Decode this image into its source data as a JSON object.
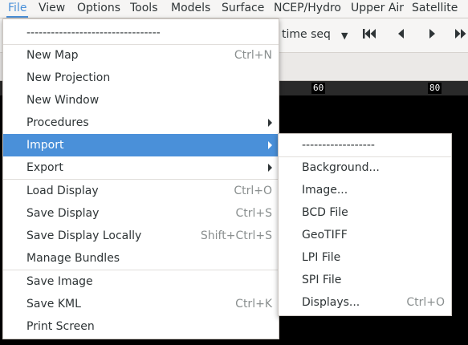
{
  "menubar": {
    "items": [
      "File",
      "View",
      "Options",
      "Tools",
      "Models",
      "Surface",
      "NCEP/Hydro",
      "Upper Air",
      "Satellite"
    ]
  },
  "toolbar": {
    "frame_select": "time seq",
    "ruler_labels": [
      "60",
      "80"
    ]
  },
  "file_menu": {
    "tearoff": "---------------------------------",
    "items": [
      {
        "label": "New Map",
        "accel": "Ctrl+N"
      },
      {
        "label": "New Projection",
        "accel": ""
      },
      {
        "label": "New Window",
        "accel": ""
      },
      {
        "label": "Procedures",
        "accel": ""
      },
      {
        "label": "Import",
        "accel": ""
      },
      {
        "label": "Export",
        "accel": ""
      },
      {
        "label": "Load Display",
        "accel": "Ctrl+O"
      },
      {
        "label": "Save Display",
        "accel": "Ctrl+S"
      },
      {
        "label": "Save Display Locally",
        "accel": "Shift+Ctrl+S"
      },
      {
        "label": "Manage Bundles",
        "accel": ""
      },
      {
        "label": "Save Image",
        "accel": ""
      },
      {
        "label": "Save KML",
        "accel": "Ctrl+K"
      },
      {
        "label": "Print Screen",
        "accel": ""
      }
    ]
  },
  "import_menu": {
    "tearoff": "------------------",
    "items": [
      {
        "label": "Background...",
        "accel": ""
      },
      {
        "label": "Image...",
        "accel": ""
      },
      {
        "label": "BCD File",
        "accel": ""
      },
      {
        "label": "GeoTIFF",
        "accel": ""
      },
      {
        "label": "LPI File",
        "accel": ""
      },
      {
        "label": "SPI File",
        "accel": ""
      },
      {
        "label": "Displays...",
        "accel": "Ctrl+O"
      }
    ]
  },
  "colors": {
    "accent": "#4a90d9",
    "menu_bg": "#ffffff",
    "chrome_bg": "#f6f5f4",
    "map_bg": "#000000"
  },
  "icons": {
    "frame_dropdown": "chevron-down-icon",
    "first_frame": "skip-to-first-icon",
    "step_back": "step-back-icon",
    "step_forward": "step-forward-icon",
    "last_frame": "skip-to-last-icon",
    "submenu": "submenu-arrow-icon"
  }
}
